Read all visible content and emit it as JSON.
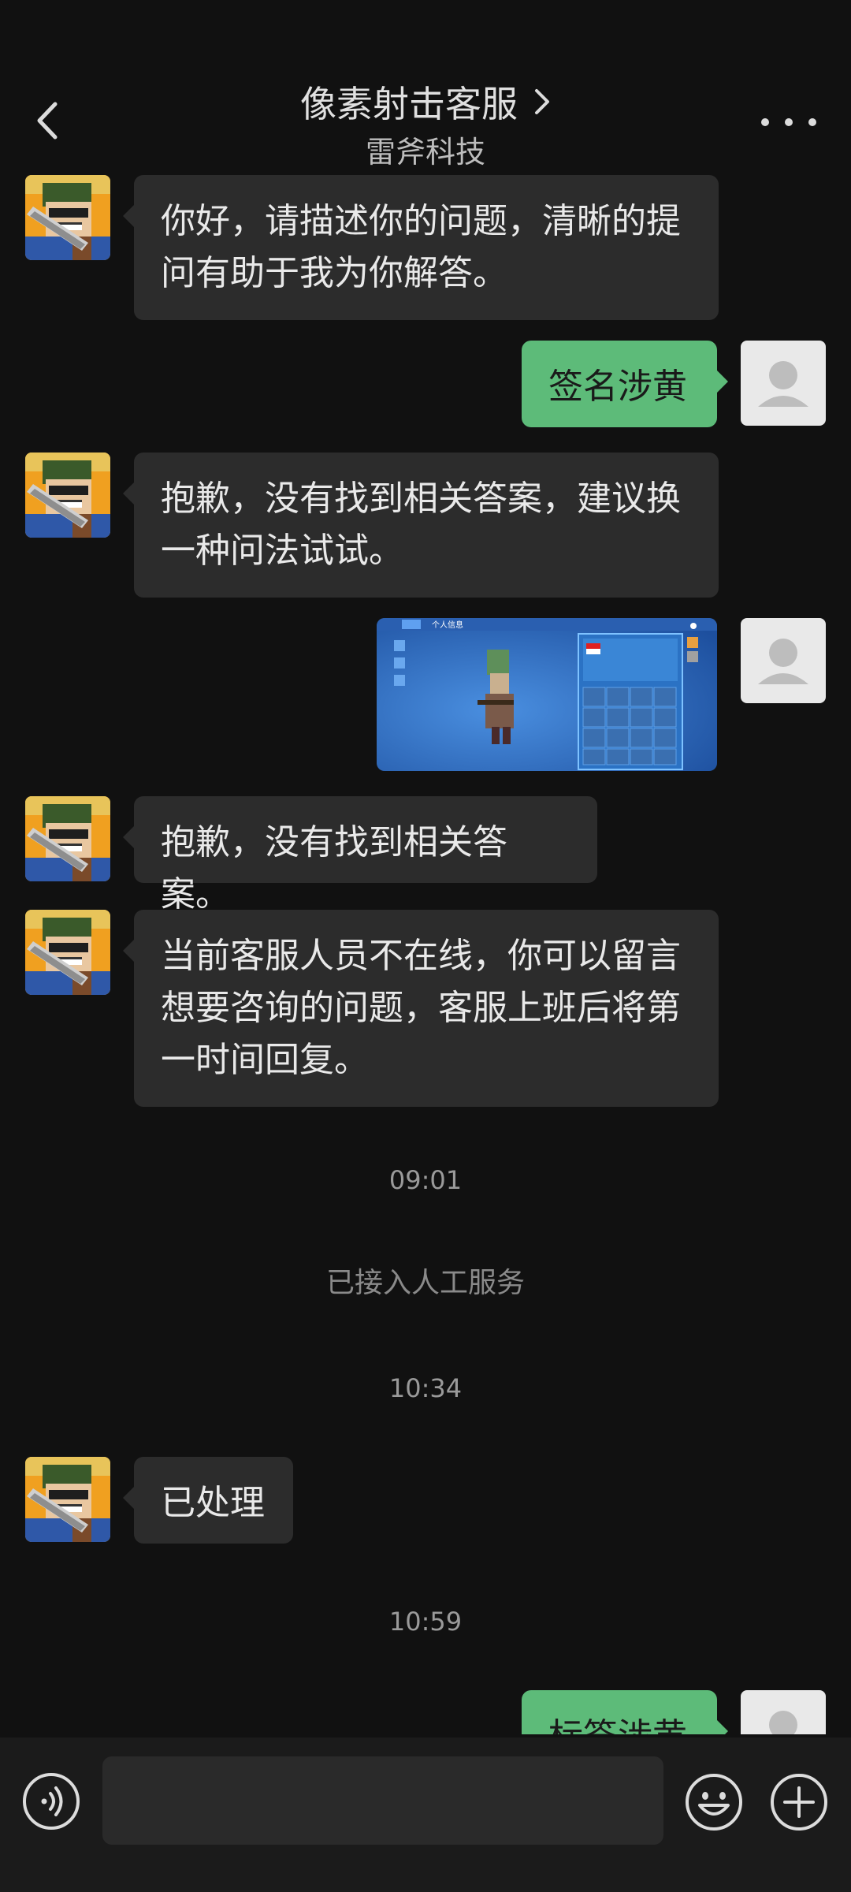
{
  "header": {
    "title": "像素射击客服",
    "subtitle": "雷斧科技"
  },
  "messages": {
    "m1": "你好，请描述你的问题，清晰的提问有助于我为你解答。",
    "m2": "签名涉黄",
    "m3": "抱歉，没有找到相关答案，建议换一种问法试试。",
    "m4_image_title": "个人信息",
    "m5": "抱歉，没有找到相关答案。",
    "m6": "当前客服人员不在线，你可以留言想要咨询的问题，客服上班后将第一时间回复。",
    "t1": "09:01",
    "sys1": "已接入人工服务",
    "t2": "10:34",
    "m7": "已处理",
    "t3": "10:59",
    "m8": "标签涉黄"
  },
  "input": {
    "value": ""
  },
  "colors": {
    "background": "#111111",
    "left_bubble": "#2c2c2c",
    "right_bubble": "#5dbb79",
    "input_bar": "#1b1b1b"
  }
}
